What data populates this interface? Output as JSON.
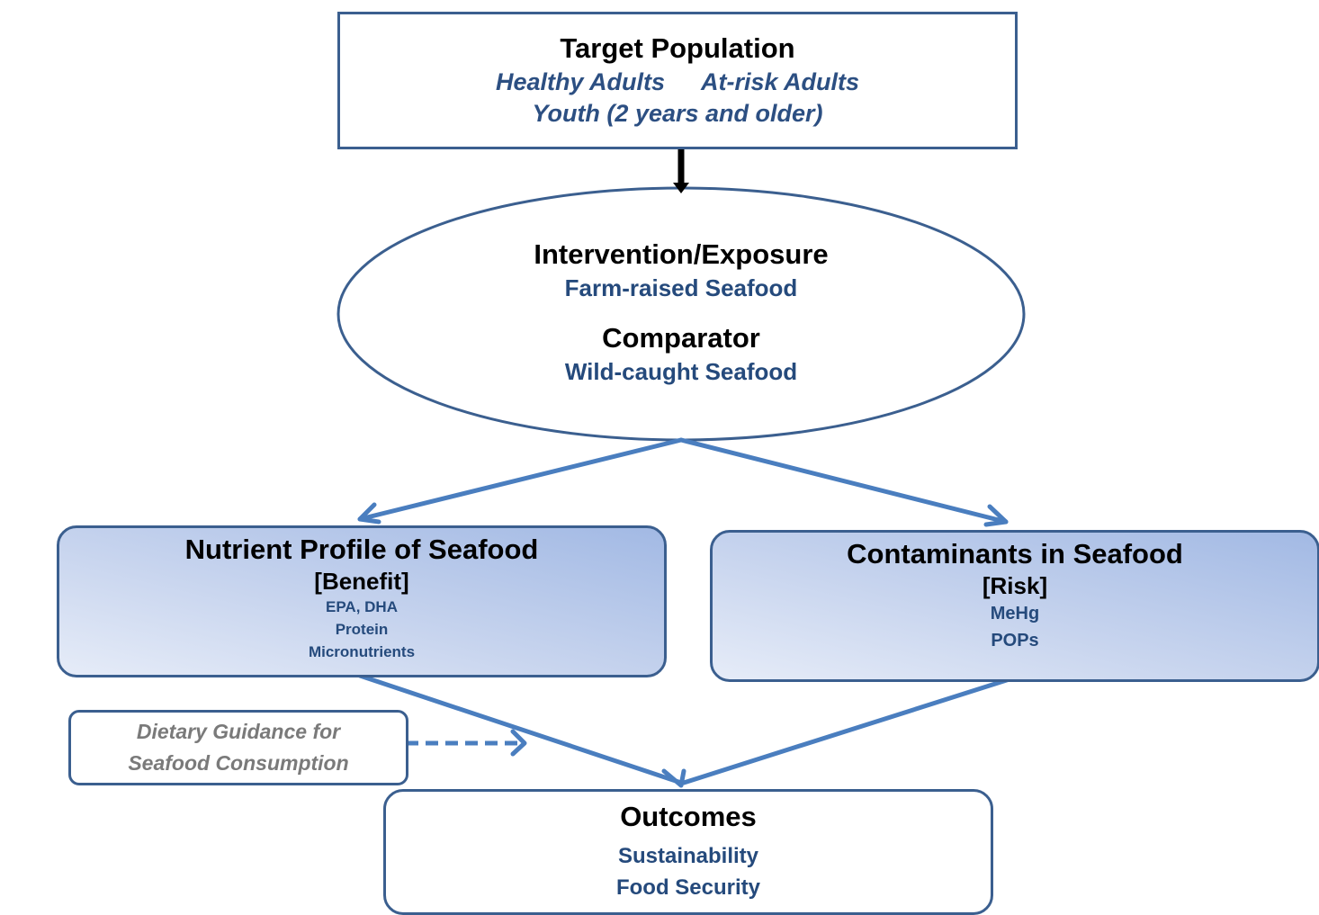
{
  "target_population": {
    "title": "Target Population",
    "groups_line1": [
      "Healthy Adults",
      "At-risk Adults"
    ],
    "groups_line2": "Youth (2 years and older)"
  },
  "intervention": {
    "title": "Intervention/Exposure",
    "value": "Farm-raised Seafood"
  },
  "comparator": {
    "title": "Comparator",
    "value": "Wild-caught Seafood"
  },
  "nutrient_profile": {
    "title": "Nutrient Profile of Seafood",
    "tag": "[Benefit]",
    "items": [
      "EPA, DHA",
      "Protein",
      "Micronutrients"
    ]
  },
  "contaminants": {
    "title": "Contaminants in Seafood",
    "tag": "[Risk]",
    "items": [
      "MeHg",
      "POPs"
    ]
  },
  "dietary_guidance": {
    "lines": [
      "Dietary Guidance for",
      "Seafood Consumption"
    ]
  },
  "outcomes": {
    "title": "Outcomes",
    "items": [
      "Sustainability",
      "Food Security"
    ]
  },
  "colors": {
    "box_border": "#3b5f8f",
    "connector": "#4a7ebf",
    "blue_text": "#254a7c",
    "gray_text": "#7a7a7a",
    "gradient_light": "#e6ecf8",
    "gradient_dark": "#a2b9e4"
  }
}
